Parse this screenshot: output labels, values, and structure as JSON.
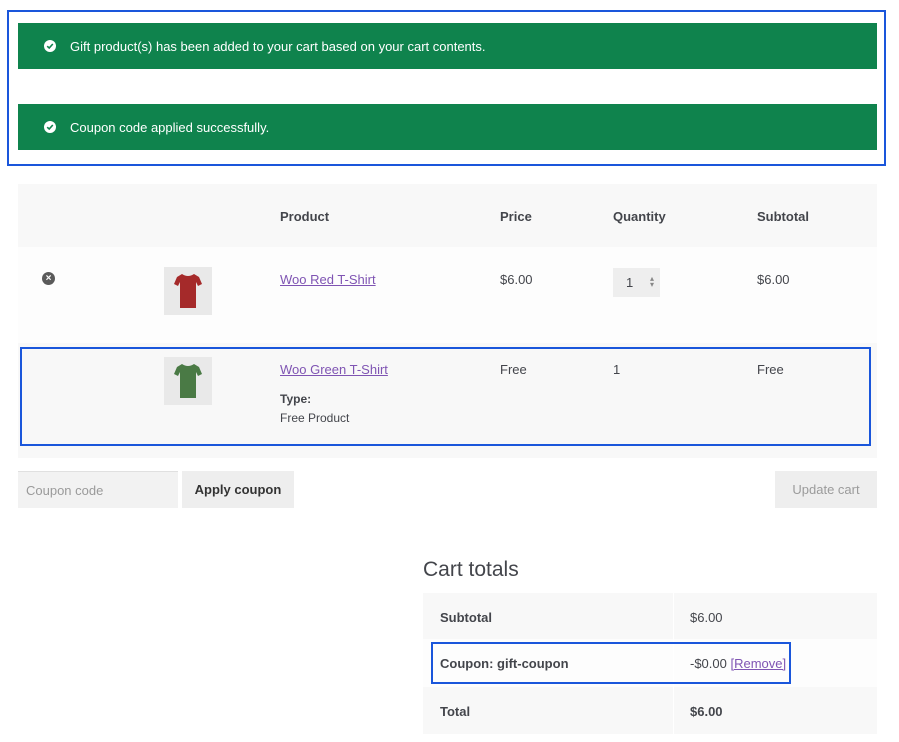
{
  "notices": [
    {
      "text": "Gift product(s) has been added to your cart based on your cart contents."
    },
    {
      "text": "Coupon code applied successfully."
    }
  ],
  "cart": {
    "headers": {
      "product": "Product",
      "price": "Price",
      "quantity": "Quantity",
      "subtotal": "Subtotal"
    },
    "items": [
      {
        "name": "Woo Red T-Shirt",
        "price": "$6.00",
        "quantity": "1",
        "subtotal": "$6.00",
        "image": "red-tshirt",
        "color": "#a52a2a"
      },
      {
        "name": "Woo Green T-Shirt",
        "price": "Free",
        "quantity": "1",
        "subtotal": "Free",
        "image": "green-tshirt",
        "color": "#4a7a45",
        "meta_label": "Type:",
        "meta_value": "Free Product"
      }
    ]
  },
  "actions": {
    "coupon_placeholder": "Coupon code",
    "apply_label": "Apply coupon",
    "update_label": "Update cart"
  },
  "totals": {
    "title": "Cart totals",
    "subtotal_label": "Subtotal",
    "subtotal_value": "$6.00",
    "coupon_label": "Coupon: gift-coupon",
    "coupon_value": "-$0.00",
    "coupon_remove": "[Remove]",
    "total_label": "Total",
    "total_value": "$6.00"
  },
  "colors": {
    "notice_bg": "#0f834d",
    "link": "#7f54b3",
    "highlight": "#1a56db"
  }
}
